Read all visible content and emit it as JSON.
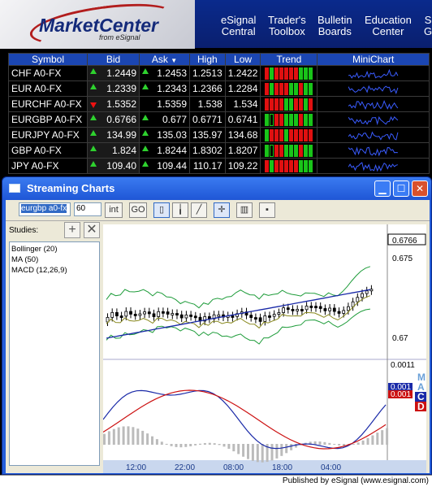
{
  "header": {
    "logo_text": "MarketCenter",
    "logo_sub": "from eSignal",
    "nav": [
      {
        "line1": "eSignal",
        "line2": "Central"
      },
      {
        "line1": "Trader's",
        "line2": "Toolbox"
      },
      {
        "line1": "Bulletin",
        "line2": "Boards"
      },
      {
        "line1": "Education",
        "line2": "Center"
      },
      {
        "line1": "S",
        "line2": "G"
      }
    ]
  },
  "quotes": {
    "columns": [
      "Symbol",
      "Bid",
      "Ask",
      "High",
      "Low",
      "Trend",
      "MiniChart"
    ],
    "rows": [
      {
        "symbol": "CHF A0-FX",
        "bid": "1.2449",
        "bid_dir": "up",
        "ask": "1.2453",
        "ask_dir": "up",
        "high": "1.2513",
        "low": "1.2422",
        "trend": [
          "tr",
          "tg",
          "tr",
          "tr",
          "tr",
          "tr",
          "tr",
          "tg",
          "tg",
          "tg"
        ]
      },
      {
        "symbol": "EUR A0-FX",
        "bid": "1.2339",
        "bid_dir": "up",
        "ask": "1.2343",
        "ask_dir": "up",
        "high": "1.2366",
        "low": "1.2284",
        "trend": [
          "tr",
          "tg",
          "tr",
          "tr",
          "tr",
          "tg",
          "tg",
          "tr",
          "tg",
          "tg"
        ]
      },
      {
        "symbol": "EURCHF A0-FX",
        "bid": "1.5352",
        "bid_dir": "down",
        "ask": "1.5359",
        "ask_dir": "",
        "high": "1.538",
        "low": "1.534",
        "trend": [
          "tr",
          "tr",
          "tr",
          "tr",
          "tg",
          "tg",
          "tr",
          "tr",
          "tg",
          "tr"
        ]
      },
      {
        "symbol": "EURGBP A0-FX",
        "bid": "0.6766",
        "bid_dir": "up",
        "ask": "0.677",
        "ask_dir": "up",
        "high": "0.6771",
        "low": "0.6741",
        "trend": [
          "tg",
          "tb",
          "tr",
          "tr",
          "tg",
          "tg",
          "tg",
          "tr",
          "tg",
          "tg"
        ]
      },
      {
        "symbol": "EURJPY A0-FX",
        "bid": "134.99",
        "bid_dir": "up",
        "ask": "135.03",
        "ask_dir": "up",
        "high": "135.97",
        "low": "134.68",
        "trend": [
          "tg",
          "tr",
          "tr",
          "tr",
          "tg",
          "tr",
          "tr",
          "tr",
          "tr",
          "tr"
        ]
      },
      {
        "symbol": "GBP A0-FX",
        "bid": "1.824",
        "bid_dir": "up",
        "ask": "1.8244",
        "ask_dir": "up",
        "high": "1.8302",
        "low": "1.8207",
        "trend": [
          "tg",
          "tb",
          "tr",
          "tr",
          "tg",
          "tg",
          "tg",
          "tr",
          "tg",
          "tg"
        ]
      },
      {
        "symbol": "JPY A0-FX",
        "bid": "109.40",
        "bid_dir": "up",
        "ask": "109.44",
        "ask_dir": "up",
        "high": "110.17",
        "low": "109.22",
        "trend": [
          "tr",
          "tg",
          "tr",
          "tr",
          "tr",
          "tr",
          "tr",
          "tg",
          "tg",
          "tg"
        ]
      }
    ]
  },
  "window": {
    "title": "Streaming Charts",
    "symbol_value": "eurgbp a0-fx",
    "interval_value": "60",
    "int_label": "int",
    "go_label": "GO",
    "studies_label": "Studies:",
    "studies": [
      "Bollinger (20)",
      "MA (50)",
      "MACD (12,26,9)"
    ]
  },
  "chart": {
    "price_labels": [
      "0.6766",
      "0.675",
      "0.67"
    ],
    "macd_labels": [
      "0.0011",
      "0.001",
      "0.001"
    ],
    "macd_letters": [
      "M",
      "A",
      "C",
      "D"
    ],
    "time_labels": [
      "12:00",
      "22:00",
      "08:00",
      "18:00",
      "04:00"
    ],
    "colors": {
      "bollinger": "#1e9c3a",
      "ma": "#8a8a20",
      "ma2": "#1a2aa8",
      "macd": "#1a2aa8",
      "signal": "#cc1111"
    }
  },
  "footer": {
    "text": "Published by eSignal (www.esignal.com)"
  }
}
